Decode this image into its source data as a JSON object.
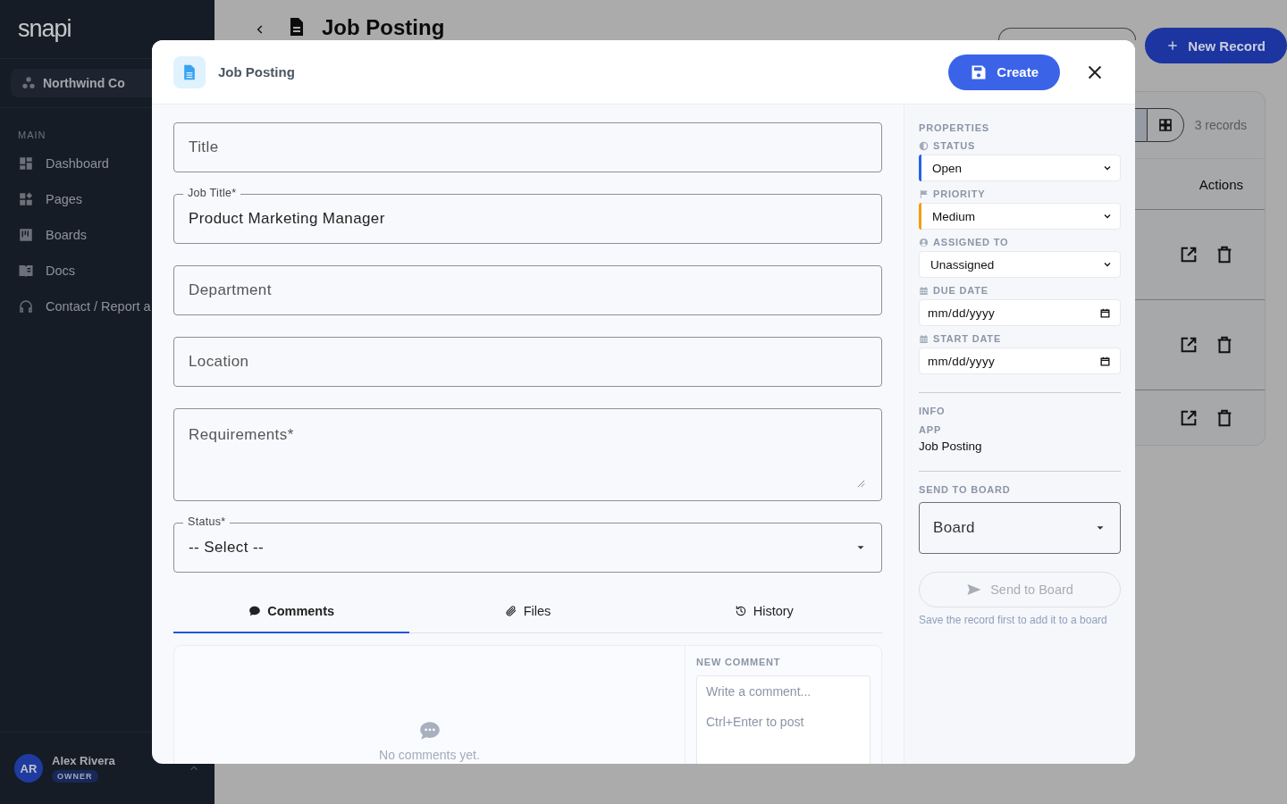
{
  "sidebar": {
    "logo": "snapi",
    "workspace": "Northwind Co",
    "section": "MAIN",
    "items": [
      {
        "label": "Dashboard"
      },
      {
        "label": "Pages"
      },
      {
        "label": "Boards"
      },
      {
        "label": "Docs"
      },
      {
        "label": "Contact / Report a"
      }
    ],
    "user": {
      "initials": "AR",
      "name": "Alex Rivera",
      "role": "OWNER"
    }
  },
  "page": {
    "title": "Job Posting",
    "new_button": "New Record",
    "view_modes": [
      {
        "selected": true
      },
      {
        "selected": false
      }
    ],
    "record_count": "3 records",
    "actions_header": "Actions",
    "rows": [
      {
        "kind": "record"
      },
      {
        "kind": "record"
      },
      {
        "kind": "record"
      }
    ]
  },
  "modal": {
    "title": "Job Posting",
    "create_button": "Create",
    "fields": [
      {
        "kind": "text",
        "label": "Title"
      },
      {
        "kind": "text",
        "label": "Job Title*",
        "value": "Product Marketing Manager"
      },
      {
        "kind": "text",
        "label": "Department"
      },
      {
        "kind": "text",
        "label": "Location"
      },
      {
        "kind": "textarea",
        "label": "Requirements*"
      },
      {
        "kind": "select",
        "label": "Status*",
        "value": "-- Select --"
      }
    ],
    "tabs": [
      {
        "label": "Comments",
        "selected": true
      },
      {
        "label": "Files",
        "selected": false
      },
      {
        "label": "History",
        "selected": false
      }
    ],
    "comments": {
      "empty_text": "No comments yet.",
      "new_comment_heading": "NEW COMMENT",
      "placeholder": "Write a comment...",
      "hint": "Ctrl+Enter to post"
    },
    "properties": {
      "heading": "PROPERTIES",
      "items": [
        {
          "kind": "select",
          "label": "STATUS",
          "value": "Open",
          "color": "#2563eb"
        },
        {
          "kind": "select",
          "label": "PRIORITY",
          "value": "Medium",
          "color": "#f59e0b"
        },
        {
          "kind": "select",
          "label": "ASSIGNED TO",
          "value": "Unassigned"
        },
        {
          "kind": "date",
          "label": "DUE DATE",
          "placeholder": "mm/dd/yyyy"
        },
        {
          "kind": "date",
          "label": "START DATE",
          "placeholder": "mm/dd/yyyy"
        }
      ]
    },
    "info": {
      "heading": "INFO",
      "app_label": "APP",
      "app_value": "Job Posting"
    },
    "send_to_board": {
      "heading": "SEND TO BOARD",
      "select_label": "Board",
      "button": "Send to Board",
      "button_disabled": true,
      "hint": "Save the record first to add it to a board"
    }
  }
}
